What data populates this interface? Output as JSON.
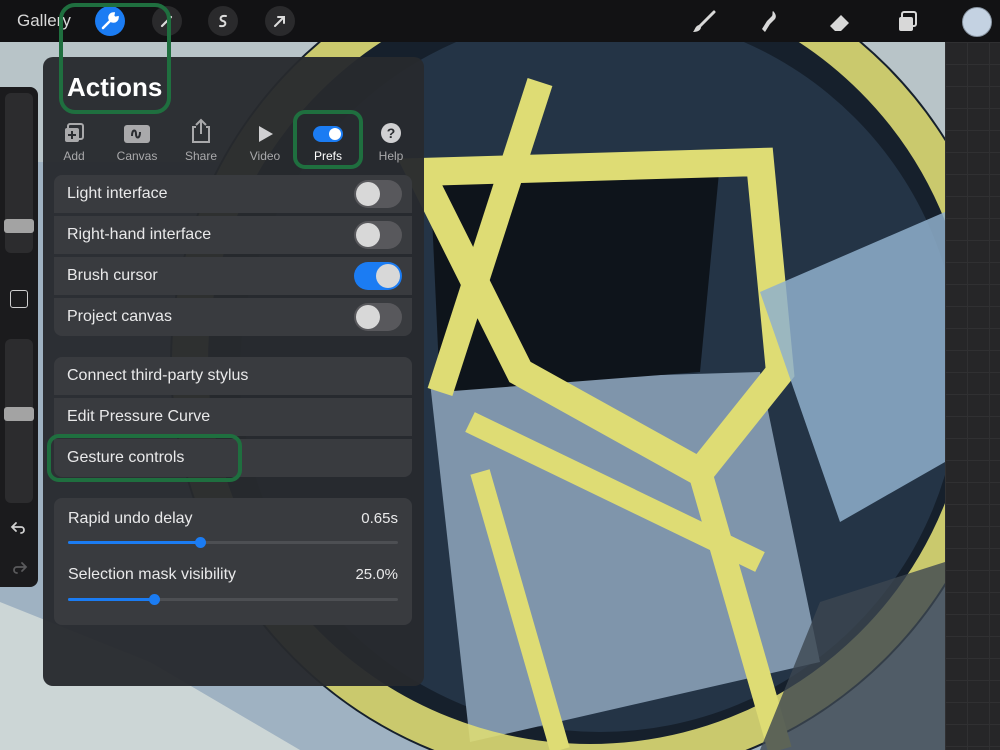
{
  "topbar": {
    "gallery_label": "Gallery",
    "left_icons": [
      "wrench-icon",
      "magic-wand-icon",
      "selection-s-icon",
      "transform-arrow-icon"
    ],
    "right_icons": [
      "brush-icon",
      "smudge-icon",
      "eraser-icon",
      "layers-icon"
    ],
    "accent_color": "#1b7cf3",
    "current_color": "#c4d2e2"
  },
  "panel": {
    "title": "Actions",
    "tabs": [
      {
        "label": "Add",
        "icon": "add-layers-icon"
      },
      {
        "label": "Canvas",
        "icon": "canvas-icon"
      },
      {
        "label": "Share",
        "icon": "share-icon"
      },
      {
        "label": "Video",
        "icon": "play-icon"
      },
      {
        "label": "Prefs",
        "icon": "toggle-icon",
        "active": true
      },
      {
        "label": "Help",
        "icon": "question-icon"
      }
    ],
    "toggles": [
      {
        "label": "Light interface",
        "on": false
      },
      {
        "label": "Right-hand interface",
        "on": false
      },
      {
        "label": "Brush cursor",
        "on": true
      },
      {
        "label": "Project canvas",
        "on": false
      }
    ],
    "links": [
      "Connect third-party stylus",
      "Edit Pressure Curve",
      "Gesture controls"
    ],
    "sliders": [
      {
        "label": "Rapid undo delay",
        "value": "0.65s",
        "fraction": 0.4
      },
      {
        "label": "Selection mask visibility",
        "value": "25.0%",
        "fraction": 0.26
      }
    ]
  },
  "highlight_color": "#1f6f3f"
}
